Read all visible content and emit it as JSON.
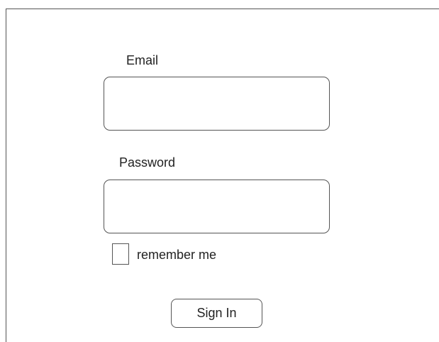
{
  "form": {
    "email_label": "Email",
    "email_value": "",
    "password_label": "Password",
    "password_value": "",
    "remember_label": "remember me",
    "remember_checked": false,
    "signin_label": "Sign In"
  }
}
